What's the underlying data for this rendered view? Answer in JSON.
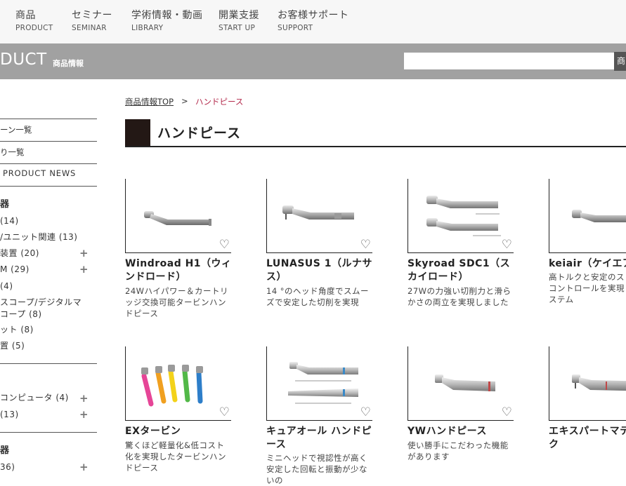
{
  "nav": [
    {
      "jp": "商品",
      "en": "PRODUCT"
    },
    {
      "jp": "セミナー",
      "en": "SEMINAR"
    },
    {
      "jp": "学術情報・動画",
      "en": "LIBRARY"
    },
    {
      "jp": "開業支援",
      "en": "START UP"
    },
    {
      "jp": "お客様サポート",
      "en": "SUPPORT"
    }
  ],
  "header": {
    "title": "DUCT",
    "subtitle": "商品情報",
    "search_placeholder": "",
    "search_button": "商品"
  },
  "sidebar": {
    "links": [
      "ーン一覧",
      "り一覧",
      "PRODUCT NEWS"
    ],
    "groups": [
      {
        "head": "器",
        "items": [
          "(14)",
          "/ユニット関連 (13)",
          "装置 (20)",
          "M (29)",
          "(4)",
          "スコープ/デジタルマ",
          "コープ (8)",
          "ット (8)",
          "置 (5)"
        ]
      },
      {
        "head": "",
        "items": [
          "コンピュータ (4)",
          "(13)"
        ]
      },
      {
        "head": "器",
        "items": [
          "36)"
        ]
      }
    ]
  },
  "breadcrumb": {
    "top": "商品情報TOP",
    "sep": ">",
    "current": "ハンドピース"
  },
  "page_title": "ハンドピース",
  "products": [
    {
      "title": "Windroad H1（ウィンドロード）",
      "desc": "24Wハイパワー＆カートリッジ交換可能タービンハンドピース",
      "image": "handpiece-straight"
    },
    {
      "title": "LUNASUS 1（ルナサス）",
      "desc": "14 °のヘッド角度でスムーズで安定した切削を実現",
      "image": "handpiece-angled"
    },
    {
      "title": "Skyroad SDC1（スカイロード）",
      "desc": "27Wの力強い切削力と滑らかさの両立を実現しました",
      "image": "handpiece-pair"
    },
    {
      "title": "keiair（ケイエア）",
      "desc": "高トルクと安定のスピードコントロールを実現したシステム",
      "image": "handpiece-straight"
    },
    {
      "title": "EXタービン",
      "desc": "驚くほど軽量化&低コスト化を実現したタービンハンドピース",
      "image": "handpiece-colors"
    },
    {
      "title": "キュアオール ハンドピース",
      "desc": "ミニヘッドで視認性が高く安定した回転と振動が少ないの",
      "image": "handpiece-contra-pair"
    },
    {
      "title": "YWハンドピース",
      "desc": "使い勝手にこだわった機能があります",
      "image": "handpiece-contra"
    },
    {
      "title": "エキスパートマティック",
      "desc": "",
      "image": "handpiece-contra"
    }
  ],
  "heart_icon": "♡",
  "plus_icon": "+"
}
